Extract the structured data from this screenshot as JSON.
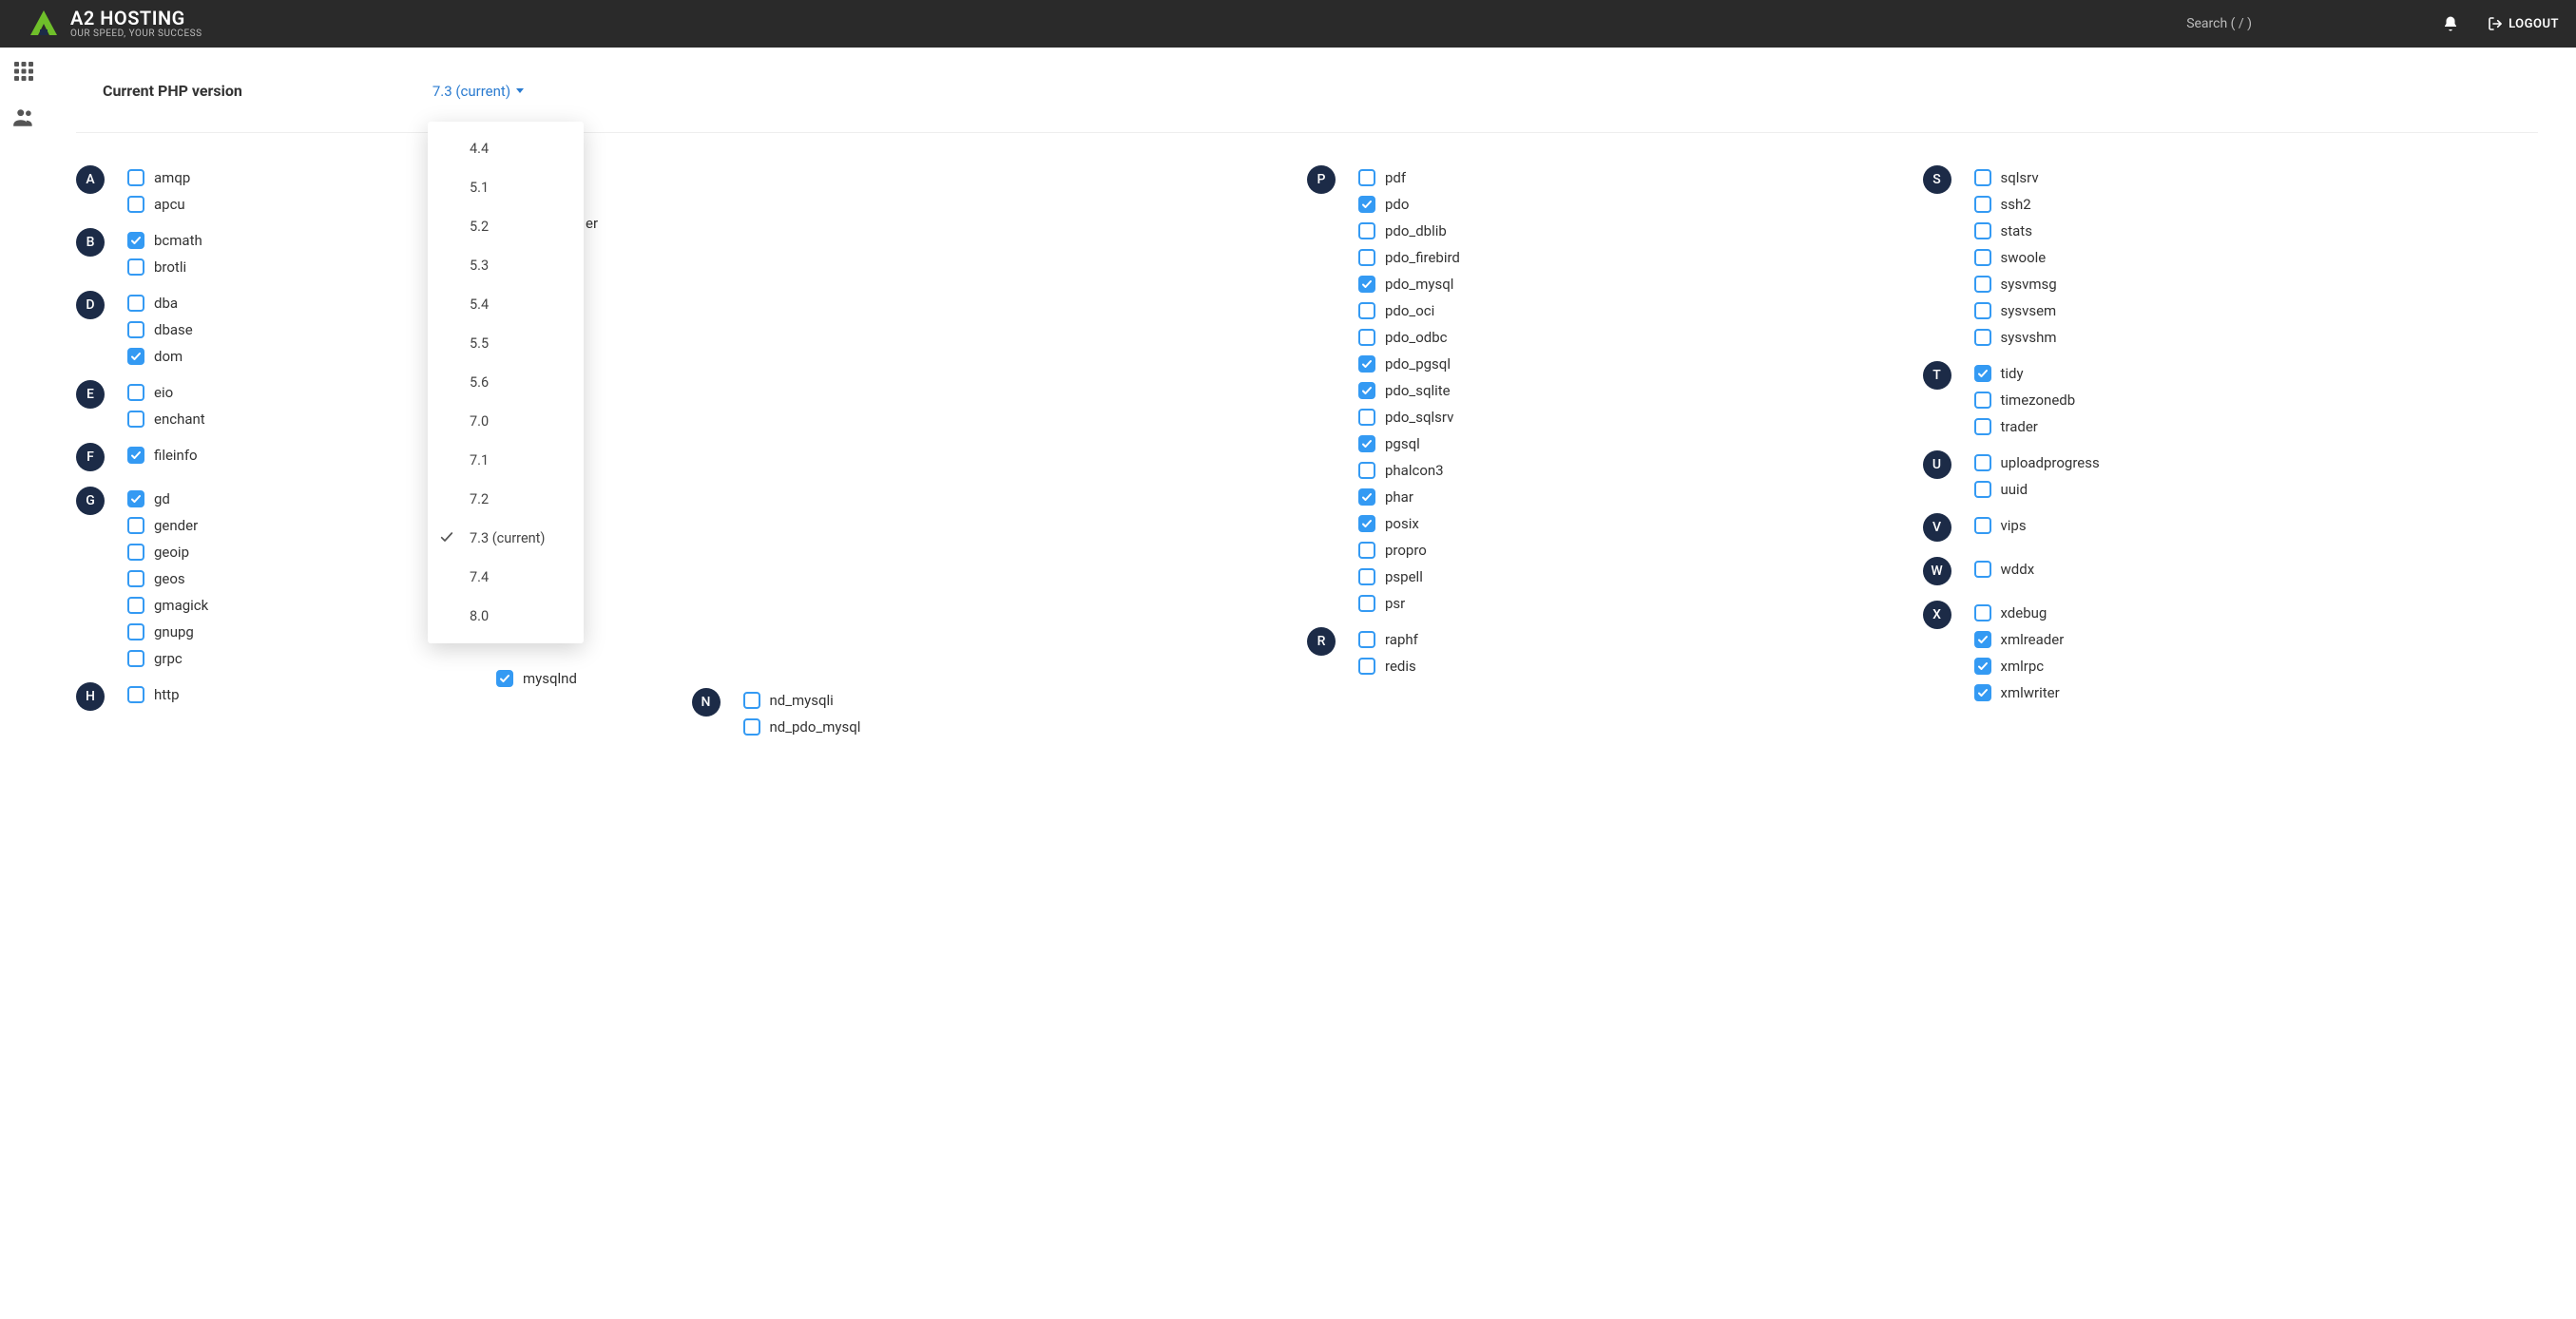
{
  "header": {
    "brand": "A2 HOSTING",
    "tagline": "OUR SPEED, YOUR SUCCESS",
    "search_label": "Search ( / )",
    "logout_label": "LOGOUT"
  },
  "version": {
    "label": "Current PHP version",
    "selected": "7.3 (current)",
    "options": [
      {
        "label": "4.4",
        "current": false
      },
      {
        "label": "5.1",
        "current": false
      },
      {
        "label": "5.2",
        "current": false
      },
      {
        "label": "5.3",
        "current": false
      },
      {
        "label": "5.4",
        "current": false
      },
      {
        "label": "5.5",
        "current": false
      },
      {
        "label": "5.6",
        "current": false
      },
      {
        "label": "7.0",
        "current": false
      },
      {
        "label": "7.1",
        "current": false
      },
      {
        "label": "7.2",
        "current": false
      },
      {
        "label": "7.3 (current)",
        "current": true
      },
      {
        "label": "7.4",
        "current": false
      },
      {
        "label": "8.0",
        "current": false
      }
    ]
  },
  "peek": {
    "er_text": "er",
    "mysqlnd_text": "mysqlnd"
  },
  "columns": [
    {
      "groups": [
        {
          "letter": "A",
          "items": [
            {
              "label": "amqp",
              "checked": false
            },
            {
              "label": "apcu",
              "checked": false
            }
          ]
        },
        {
          "letter": "B",
          "items": [
            {
              "label": "bcmath",
              "checked": true
            },
            {
              "label": "brotli",
              "checked": false
            }
          ]
        },
        {
          "letter": "D",
          "items": [
            {
              "label": "dba",
              "checked": false
            },
            {
              "label": "dbase",
              "checked": false
            },
            {
              "label": "dom",
              "checked": true
            }
          ]
        },
        {
          "letter": "E",
          "items": [
            {
              "label": "eio",
              "checked": false
            },
            {
              "label": "enchant",
              "checked": false
            }
          ]
        },
        {
          "letter": "F",
          "items": [
            {
              "label": "fileinfo",
              "checked": true
            }
          ]
        },
        {
          "letter": "G",
          "items": [
            {
              "label": "gd",
              "checked": true
            },
            {
              "label": "gender",
              "checked": false
            },
            {
              "label": "geoip",
              "checked": false
            },
            {
              "label": "geos",
              "checked": false
            },
            {
              "label": "gmagick",
              "checked": false
            },
            {
              "label": "gnupg",
              "checked": false
            },
            {
              "label": "grpc",
              "checked": false
            }
          ]
        },
        {
          "letter": "H",
          "items": [
            {
              "label": "http",
              "checked": false
            }
          ]
        }
      ]
    },
    {
      "groups": [
        {
          "letter": "N",
          "items": [
            {
              "label": "nd_mysqli",
              "checked": false
            },
            {
              "label": "nd_pdo_mysql",
              "checked": false
            }
          ]
        }
      ]
    },
    {
      "groups": [
        {
          "letter": "P",
          "items": [
            {
              "label": "pdf",
              "checked": false
            },
            {
              "label": "pdo",
              "checked": true
            },
            {
              "label": "pdo_dblib",
              "checked": false
            },
            {
              "label": "pdo_firebird",
              "checked": false
            },
            {
              "label": "pdo_mysql",
              "checked": true
            },
            {
              "label": "pdo_oci",
              "checked": false
            },
            {
              "label": "pdo_odbc",
              "checked": false
            },
            {
              "label": "pdo_pgsql",
              "checked": true
            },
            {
              "label": "pdo_sqlite",
              "checked": true
            },
            {
              "label": "pdo_sqlsrv",
              "checked": false
            },
            {
              "label": "pgsql",
              "checked": true
            },
            {
              "label": "phalcon3",
              "checked": false
            },
            {
              "label": "phar",
              "checked": true
            },
            {
              "label": "posix",
              "checked": true
            },
            {
              "label": "propro",
              "checked": false
            },
            {
              "label": "pspell",
              "checked": false
            },
            {
              "label": "psr",
              "checked": false
            }
          ]
        },
        {
          "letter": "R",
          "items": [
            {
              "label": "raphf",
              "checked": false
            },
            {
              "label": "redis",
              "checked": false
            }
          ]
        }
      ]
    },
    {
      "groups": [
        {
          "letter": "S",
          "items": [
            {
              "label": "sqlsrv",
              "checked": false
            },
            {
              "label": "ssh2",
              "checked": false
            },
            {
              "label": "stats",
              "checked": false
            },
            {
              "label": "swoole",
              "checked": false
            },
            {
              "label": "sysvmsg",
              "checked": false
            },
            {
              "label": "sysvsem",
              "checked": false
            },
            {
              "label": "sysvshm",
              "checked": false
            }
          ]
        },
        {
          "letter": "T",
          "items": [
            {
              "label": "tidy",
              "checked": true
            },
            {
              "label": "timezonedb",
              "checked": false
            },
            {
              "label": "trader",
              "checked": false
            }
          ]
        },
        {
          "letter": "U",
          "items": [
            {
              "label": "uploadprogress",
              "checked": false
            },
            {
              "label": "uuid",
              "checked": false
            }
          ]
        },
        {
          "letter": "V",
          "items": [
            {
              "label": "vips",
              "checked": false
            }
          ]
        },
        {
          "letter": "W",
          "items": [
            {
              "label": "wddx",
              "checked": false
            }
          ]
        },
        {
          "letter": "X",
          "items": [
            {
              "label": "xdebug",
              "checked": false
            },
            {
              "label": "xmlreader",
              "checked": true
            },
            {
              "label": "xmlrpc",
              "checked": true
            },
            {
              "label": "xmlwriter",
              "checked": true
            }
          ]
        }
      ]
    }
  ]
}
